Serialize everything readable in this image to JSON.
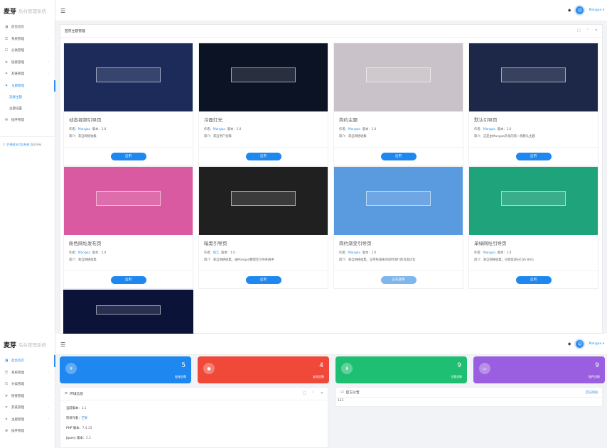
{
  "app": {
    "logo_mark": "麦芽",
    "logo_text": "后台管理系统"
  },
  "user": {
    "name": "Mangoa"
  },
  "nav": {
    "items": [
      {
        "label": "后台首页",
        "icon": "dashboard-icon",
        "glyph": "◑"
      },
      {
        "label": "系统管理",
        "icon": "sliders-icon",
        "glyph": "☰"
      },
      {
        "label": "分类管理",
        "icon": "list-icon",
        "glyph": "☷"
      },
      {
        "label": "链接管理",
        "icon": "send-icon",
        "glyph": "➤"
      },
      {
        "label": "友链管理",
        "icon": "link-icon",
        "glyph": "⚭"
      },
      {
        "label": "主题管理",
        "icon": "theme-icon",
        "glyph": "✦"
      },
      {
        "label": "插件管理",
        "icon": "plugin-icon",
        "glyph": "⊕"
      }
    ],
    "theme_sub": [
      "选择主题",
      "主题设置"
    ],
    "footer_link": "芒果网址引导系统",
    "footer_text": "版权所有"
  },
  "panel": {
    "title": "首页主题管理"
  },
  "themes": [
    {
      "title": "动态视频引导页",
      "author": "Mangoa",
      "version": "1.0",
      "desc": "来自网络收集",
      "button": "启用",
      "used": false,
      "bg": "#1c2b5a"
    },
    {
      "title": "冷面灯光",
      "author": "Mangoa",
      "version": "1.0",
      "desc": "来自用户投稿",
      "button": "启用",
      "used": false,
      "bg": "#0c1324"
    },
    {
      "title": "简约主题",
      "author": "Mangoa",
      "version": "1.0",
      "desc": "来自网络收集",
      "button": "启用",
      "used": false,
      "bg": "#c9c2c8"
    },
    {
      "title": "默认引导页",
      "author": "Mangoa",
      "version": "1.0",
      "desc": "这是由Mangoa开发的第一款默认主题",
      "button": "启用",
      "used": false,
      "bg": "#1d2848"
    },
    {
      "title": "粉色网址发布页",
      "author": "Mangoa",
      "version": "1.0",
      "desc": "来自网络收集",
      "button": "启用",
      "used": false,
      "bg": "#d95aa0"
    },
    {
      "title": "暗黑引导页",
      "author": "程江",
      "version": "1.0",
      "desc": "来自网络收集，由Mangoa整理至引导系统中",
      "button": "启用",
      "used": false,
      "bg": "#202020"
    },
    {
      "title": "简约渐变引导页",
      "author": "Mangoa",
      "version": "1.0",
      "desc": "来自网络收集，应用色调来的同时进行的页面优化",
      "button": "正在使用",
      "used": true,
      "bg": "#5a9be0"
    },
    {
      "title": "单绿网址引导页",
      "author": "Mangoa",
      "version": "1.0",
      "desc": "来自网络收集，已修复部分CSS BUG",
      "button": "启用",
      "used": false,
      "bg": "#1fa37a"
    },
    {
      "title": "",
      "author": "",
      "version": "",
      "desc": "",
      "button": "",
      "used": false,
      "bg": "#0b1338"
    }
  ],
  "labels": {
    "author": "作者：",
    "version": "版本：",
    "desc": "简介："
  },
  "stats": [
    {
      "value": "5",
      "label": "链接总数",
      "color": "#1e87f0",
      "glyph": "¥"
    },
    {
      "value": "4",
      "label": "友链总数",
      "color": "#f0493a",
      "glyph": "●"
    },
    {
      "value": "9",
      "label": "主题总数",
      "color": "#1fbf73",
      "glyph": "⬇"
    },
    {
      "value": "9",
      "label": "插件总数",
      "color": "#9a5fe0",
      "glyph": "▭"
    }
  ],
  "env": {
    "title": "环境信息",
    "rows": [
      {
        "k": "当前版本：",
        "v": "1.1"
      },
      {
        "k": "项目作者：",
        "v": "芒果"
      },
      {
        "k": "PHP 版本：",
        "v": "7.4.33"
      },
      {
        "k": "Jquery 版本：",
        "v": "2.5"
      }
    ]
  },
  "notice": {
    "title": "官方公告",
    "more": "官方网站",
    "body": "123"
  }
}
